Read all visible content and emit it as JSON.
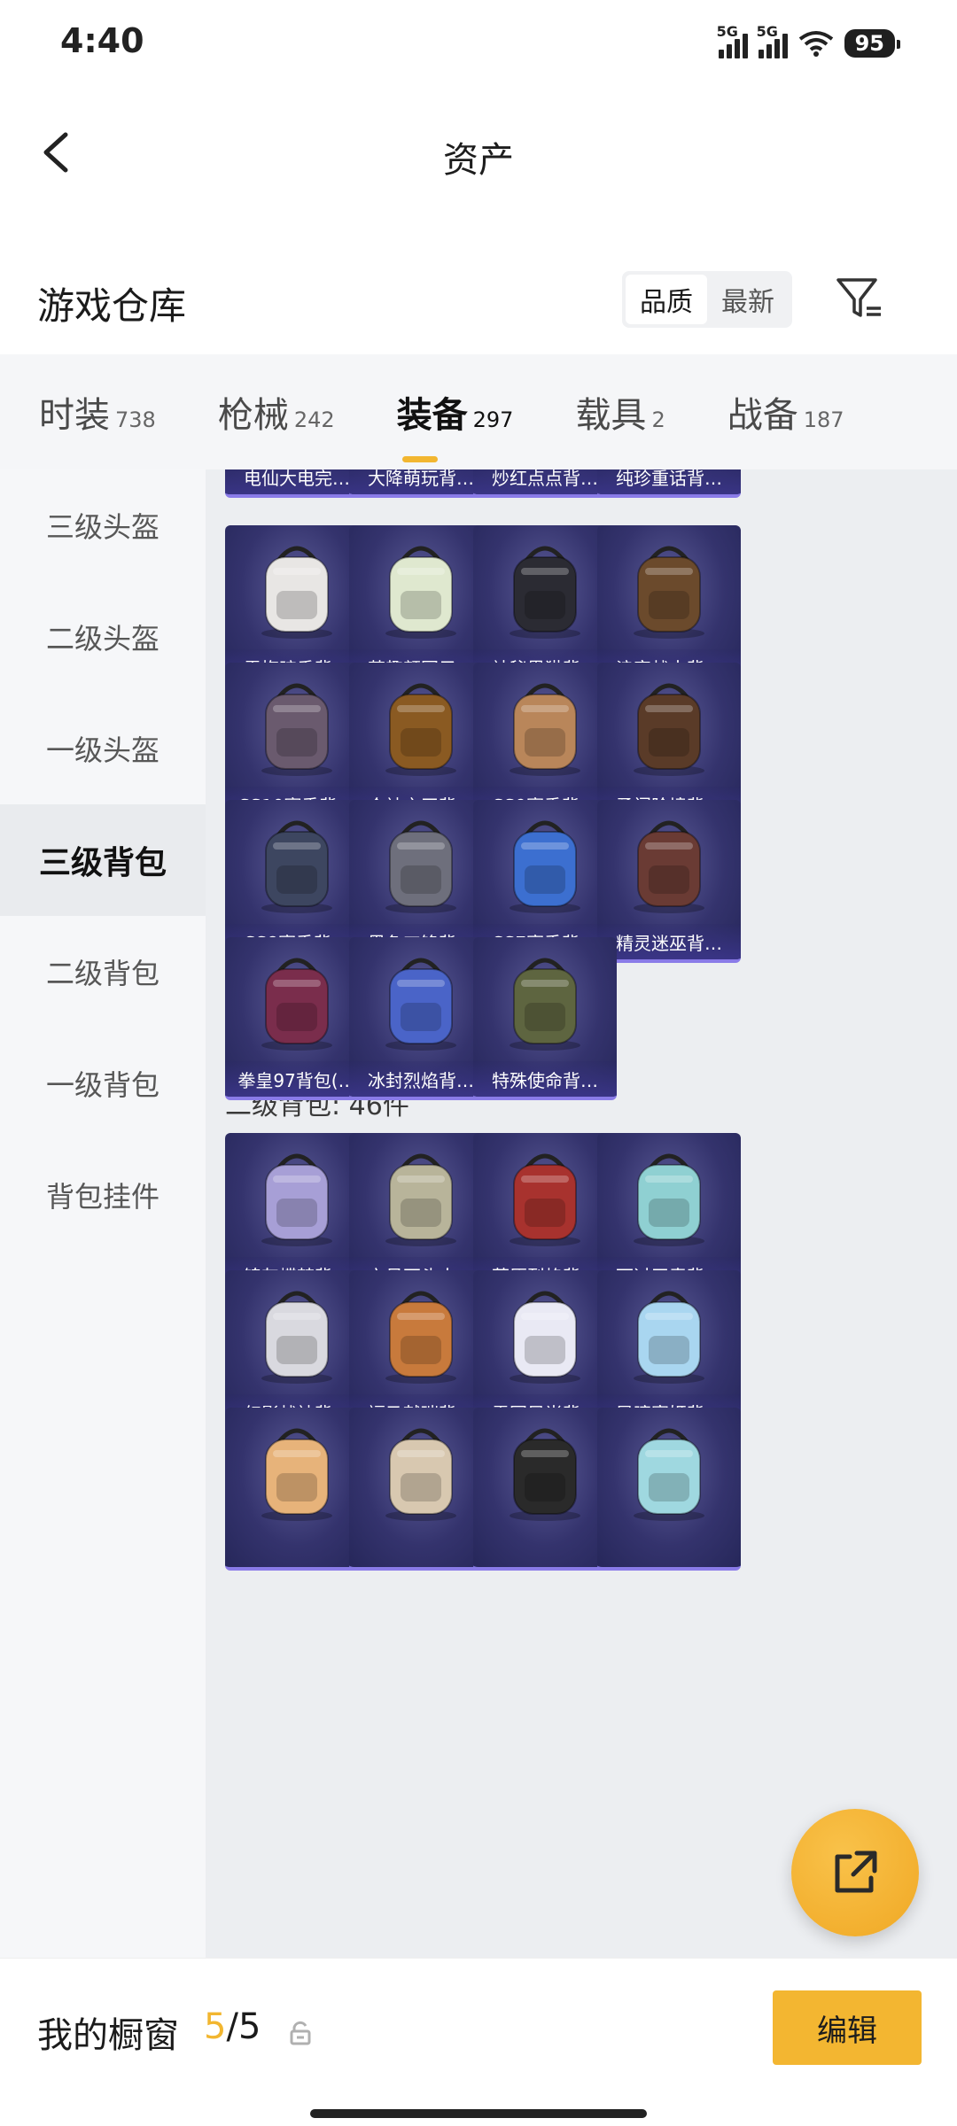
{
  "status_bar": {
    "time": "4:40",
    "signal1": "5G",
    "signal2": "5G",
    "battery": "95"
  },
  "header": {
    "title": "资产"
  },
  "warehouse": {
    "title": "游戏仓库",
    "sort_options": [
      "品质",
      "最新"
    ],
    "active_sort": "品质"
  },
  "tabs": [
    {
      "label": "时装",
      "count": "738"
    },
    {
      "label": "枪械",
      "count": "242"
    },
    {
      "label": "装备",
      "count": "297",
      "active": true
    },
    {
      "label": "载具",
      "count": "2"
    },
    {
      "label": "战备",
      "count": "187"
    }
  ],
  "sidebar": [
    {
      "label": "三级头盔"
    },
    {
      "label": "二级头盔"
    },
    {
      "label": "一级头盔"
    },
    {
      "label": "三级背包",
      "active": true
    },
    {
      "label": "二级背包"
    },
    {
      "label": "一级背包"
    },
    {
      "label": "背包挂件"
    }
  ],
  "partial_top_items": [
    "电仙大电完…",
    "大降萌玩背…",
    "炒红点点背…",
    "纯珍重话背…"
  ],
  "level3_items": [
    {
      "name": "雪梅暗香背…",
      "icon": "backpack-plum-icon",
      "color": "#e8e6e4"
    },
    {
      "name": "萌趣颜团子…",
      "icon": "backpack-sprout-icon",
      "color": "#dfe8cf"
    },
    {
      "name": "神秘黑猫背…",
      "icon": "backpack-cat-icon",
      "color": "#2b2b33"
    },
    {
      "name": "浪客战士背…",
      "icon": "backpack-warrior-icon",
      "color": "#6b4a2c"
    },
    {
      "name": "SS10赛季背…",
      "icon": "backpack-ss10-icon",
      "color": "#6a5a6e"
    },
    {
      "name": "众神之王背…",
      "icon": "backpack-gold-icon",
      "color": "#8a5a22"
    },
    {
      "name": "SS9赛季背…",
      "icon": "backpack-ss9-icon",
      "color": "#b9865a"
    },
    {
      "name": "勇闯险境背…",
      "icon": "backpack-explorer-icon",
      "color": "#5a3b28"
    },
    {
      "name": "SS8赛季背…",
      "icon": "backpack-ss8-icon",
      "color": "#3d4660"
    },
    {
      "name": "黑色刀锋背…",
      "icon": "backpack-blade-icon",
      "color": "#6e6f7c"
    },
    {
      "name": "SS7赛季背…",
      "icon": "backpack-ss7-icon",
      "color": "#3c6fd0"
    },
    {
      "name": "精灵迷巫背…",
      "icon": "backpack-elf-icon",
      "color": "#6a3b34"
    },
    {
      "name": "拳皇97背包(…",
      "icon": "backpack-kof-icon",
      "color": "#7a2d4c"
    },
    {
      "name": "冰封烈焰背…",
      "icon": "backpack-flame-icon",
      "color": "#4a64c8"
    },
    {
      "name": "特殊使命背…",
      "icon": "backpack-tactical-icon",
      "color": "#5e6540"
    }
  ],
  "section_level2": {
    "label": "二级背包: 46件"
  },
  "level2_items": [
    {
      "name": "锦灰蝶梦背…",
      "icon": "backpack-butterfly-icon",
      "color": "#a79fd6"
    },
    {
      "name": "六号石头人…",
      "icon": "backpack-stone-icon",
      "color": "#b8b49a"
    },
    {
      "name": "荒原烈焰背…",
      "icon": "backpack-wasteland-icon",
      "color": "#a8322e"
    },
    {
      "name": "雨过天青背…",
      "icon": "backpack-celadon-icon",
      "color": "#8fd0d2"
    },
    {
      "name": "幻影战神背…",
      "icon": "backpack-phantom-icon",
      "color": "#d9d9df"
    },
    {
      "name": "福马献瑞背…",
      "icon": "backpack-horse-icon",
      "color": "#c87a3c"
    },
    {
      "name": "雪国风尚背…",
      "icon": "backpack-snow-icon",
      "color": "#e9e9f4"
    },
    {
      "name": "异瞳寒姬背…",
      "icon": "backpack-iceprincess-icon",
      "color": "#a9d6f0"
    },
    {
      "name": "",
      "icon": "backpack-donut-icon",
      "color": "#e7b37a"
    },
    {
      "name": "",
      "icon": "backpack-bunny-icon",
      "color": "#d8c8b0"
    },
    {
      "name": "",
      "icon": "backpack-black-icon",
      "color": "#2a2a2a"
    },
    {
      "name": "",
      "icon": "backpack-crystal-icon",
      "color": "#9fd8e0"
    }
  ],
  "fab": {
    "icon": "share-external-icon"
  },
  "bottom": {
    "title": "我的橱窗",
    "count_current": "5",
    "count_sep": "/",
    "count_total": "5",
    "edit_label": "编辑"
  },
  "colors": {
    "accent": "#f2b630",
    "card_bg": "#34336d",
    "card_border": "#8a7be8"
  }
}
